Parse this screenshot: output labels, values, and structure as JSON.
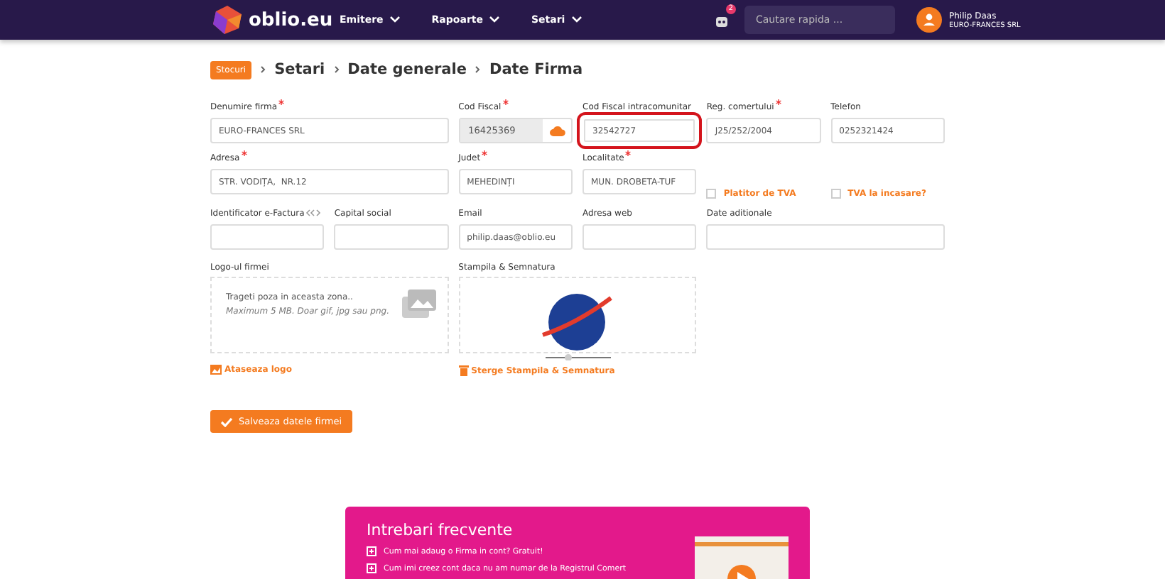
{
  "header": {
    "logo": "oblio.eu",
    "menu": [
      {
        "label": "Emitere"
      },
      {
        "label": "Rapoarte"
      },
      {
        "label": "Setari"
      }
    ],
    "notifications_badge": "2",
    "search": {
      "placeholder": "Cautare rapida ..."
    },
    "user": {
      "name": "Philip Daas",
      "company": "EURO-FRANCES SRL"
    }
  },
  "breadcrumb": {
    "badge": "Stocuri",
    "items": [
      "Setari",
      "Date generale",
      "Date Firma"
    ]
  },
  "fields": [
    {
      "kind": "input",
      "label": "Denumire firma",
      "required": true,
      "value": "EURO-FRANCES SRL"
    },
    {
      "kind": "cloud",
      "label": "Cod Fiscal",
      "required": true,
      "value": "16425369"
    },
    {
      "kind": "input",
      "label": "Cod Fiscal intracomunitar",
      "required": false,
      "value": "32542727",
      "highlighted": true
    },
    {
      "kind": "input",
      "label": "Reg. comertului",
      "required": true,
      "value": "J25/252/2004"
    },
    {
      "kind": "input",
      "label": "Telefon",
      "required": false,
      "value": "0252321424"
    },
    {
      "kind": "input",
      "label": "Adresa",
      "required": true,
      "value": "STR. VODIȚA,  NR.12"
    },
    {
      "kind": "input",
      "label": "Judet",
      "required": true,
      "value": "MEHEDINȚI"
    },
    {
      "kind": "input",
      "label": "Localitate",
      "required": true,
      "value": "MUN. DROBETA-TUF"
    },
    {
      "kind": "checkbox",
      "label": "Platitor de TVA",
      "checked": false
    },
    {
      "kind": "checkbox",
      "label": "TVA la incasare?",
      "checked": false
    },
    {
      "kind": "input",
      "label": "Identificator e-Factura",
      "required": false,
      "info": true
    },
    {
      "kind": "input",
      "label": "Capital social",
      "required": false
    },
    {
      "kind": "input",
      "label": "Email",
      "required": false,
      "value": "philip.daas@oblio.eu"
    },
    {
      "kind": "input",
      "label": "Adresa web",
      "required": false
    },
    {
      "kind": "input",
      "label": "Date aditionale",
      "required": false
    }
  ],
  "uploads": [
    {
      "kind": "empty",
      "label": "Logo-ul firmei",
      "hint": "Trageti poza in aceasta zona..",
      "note": "Maximum 5 MB. Doar gif, jpg sau png.",
      "action": "Ataseaza logo"
    },
    {
      "kind": "image",
      "label": "Stampila & Semnatura",
      "action": "Sterge Stampila & Semnatura"
    }
  ],
  "save_button": "Salveaza datele firmei",
  "faq": {
    "title": "Intrebari frecvente",
    "items": [
      "Cum mai adaug o Firma in cont? Gratuit!",
      "Cum imi creez cont daca nu am numar de la Registrul Comert"
    ]
  }
}
